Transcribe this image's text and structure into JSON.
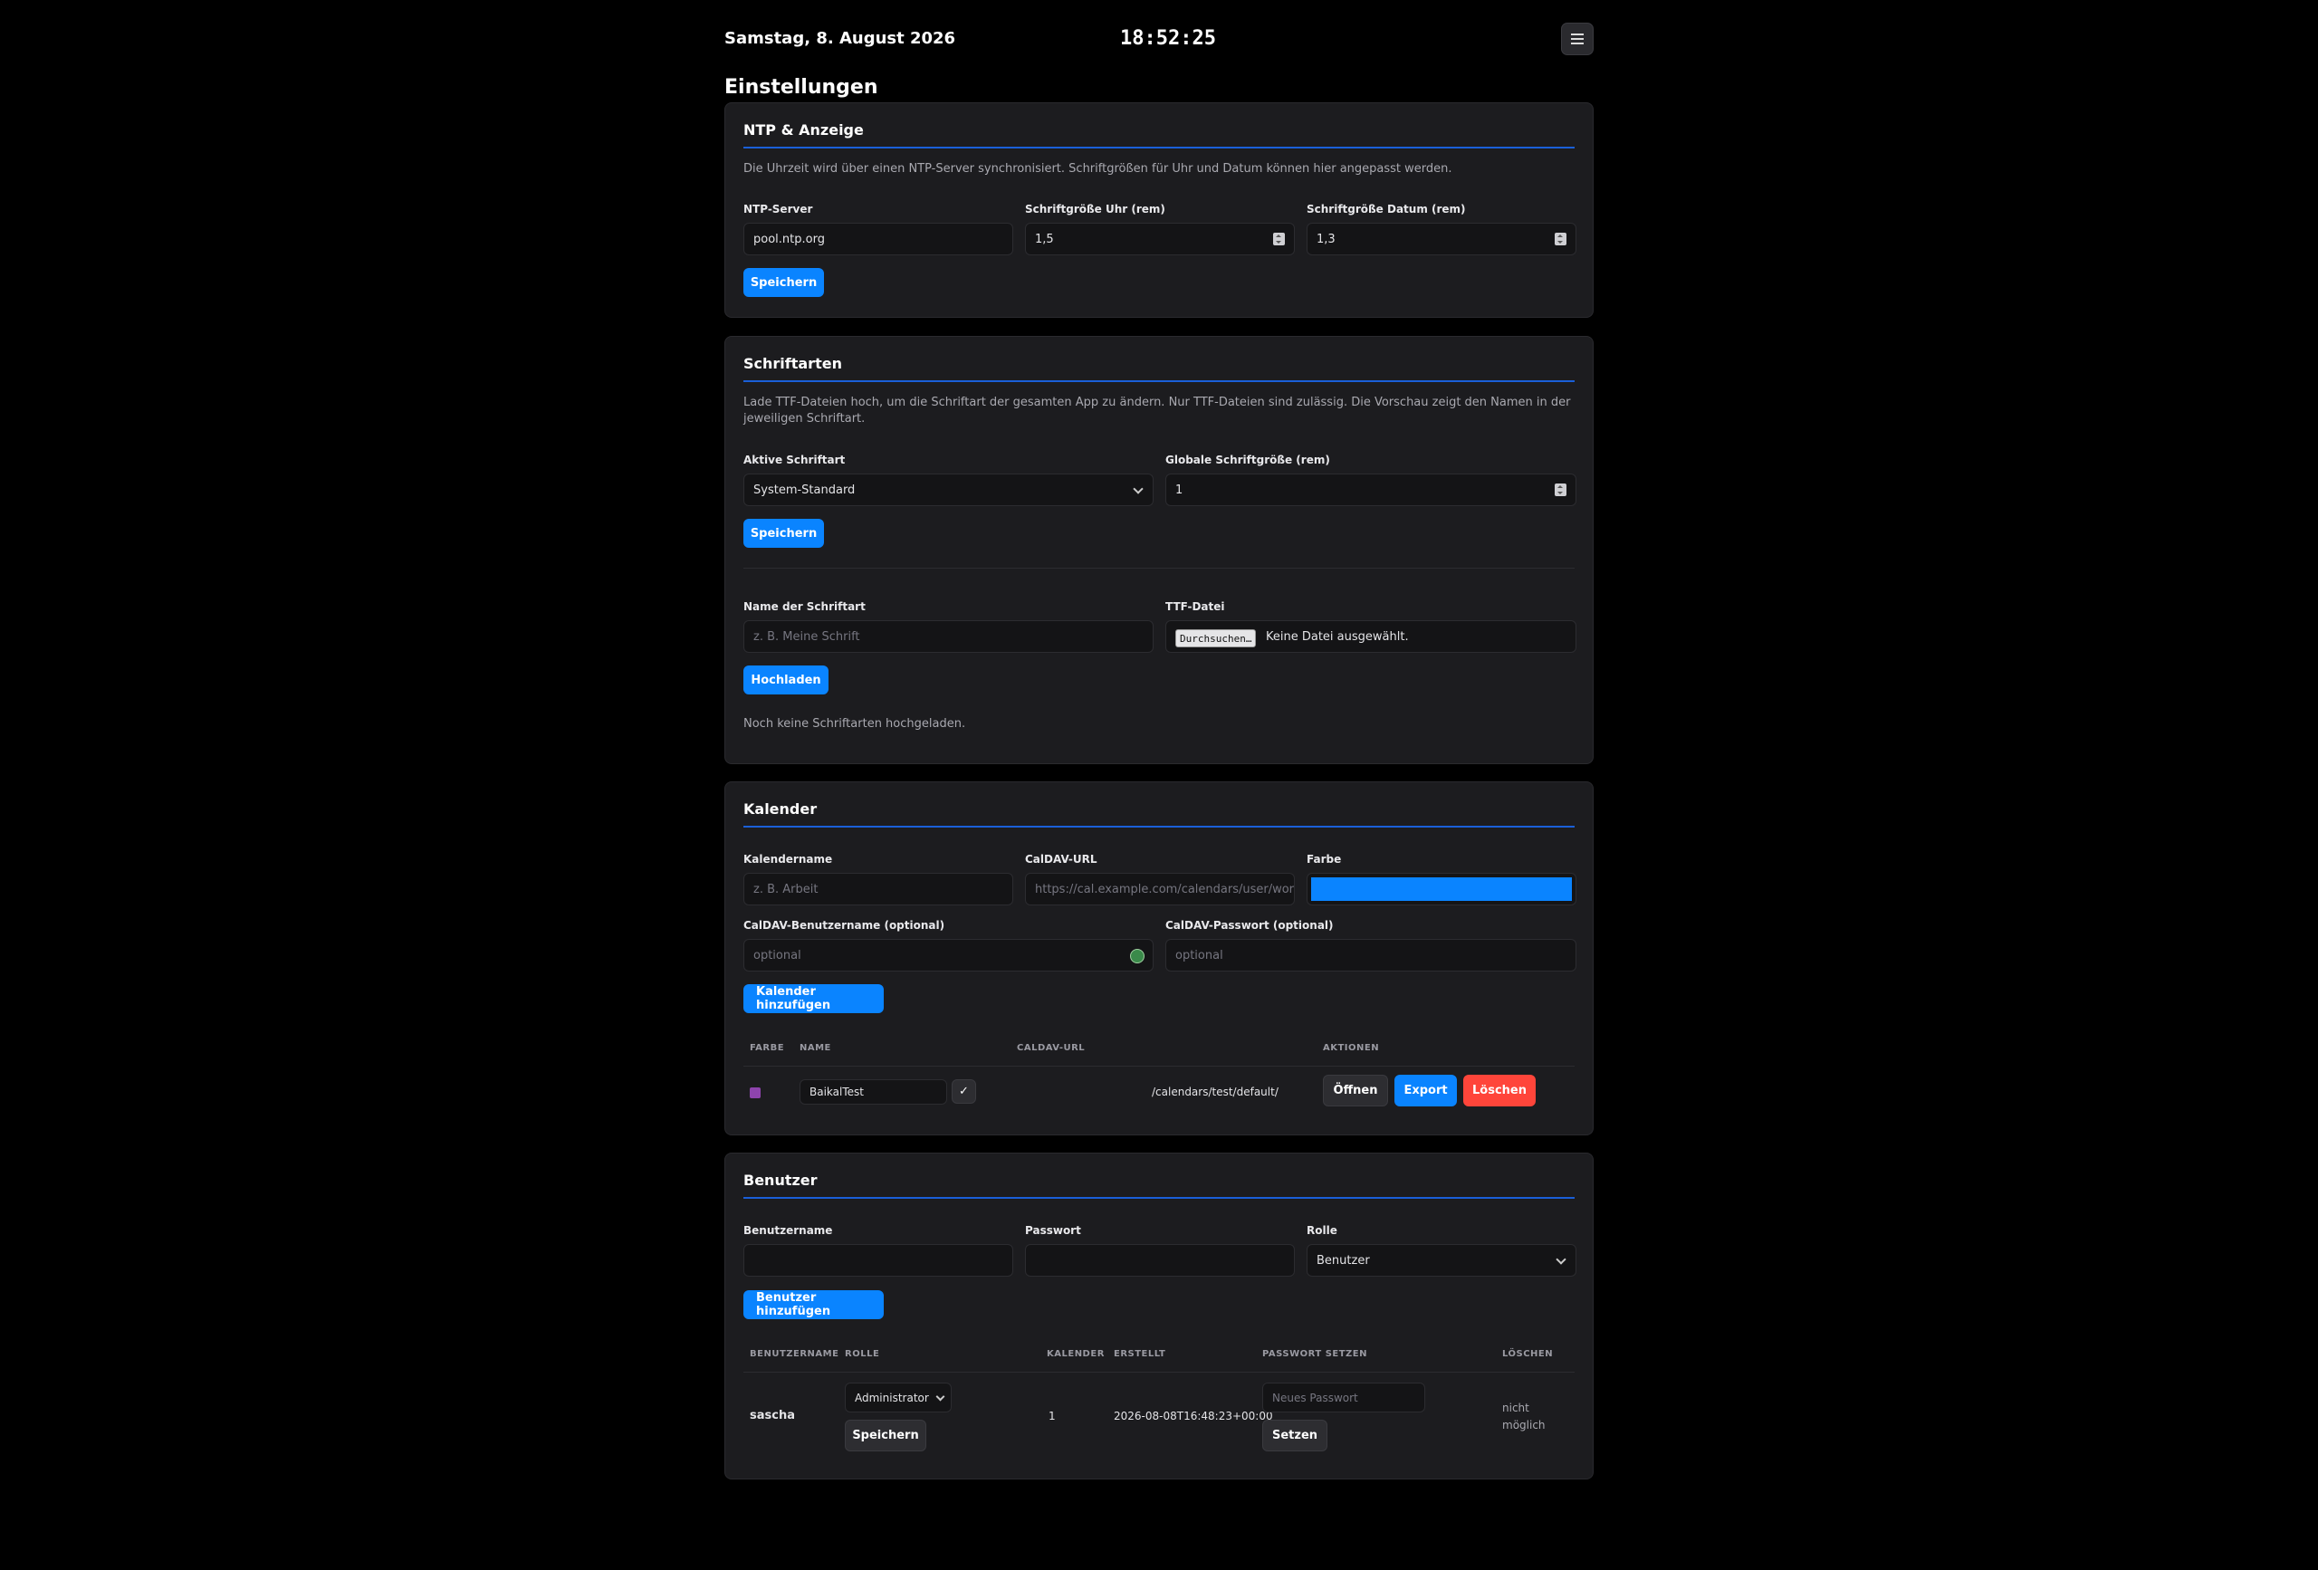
{
  "header": {
    "date": "Samstag, 8. August 2026",
    "time": "18:52:25",
    "menu_icon": "hamburger-icon"
  },
  "page": {
    "title": "Einstellungen"
  },
  "ntp": {
    "title": "NTP & Anzeige",
    "description": "Die Uhrzeit wird über einen NTP-Server synchronisiert. Schriftgrößen für Uhr und Datum können hier angepasst werden.",
    "server_label": "NTP-Server",
    "server_value": "pool.ntp.org",
    "clock_size_label": "Schriftgröße Uhr (rem)",
    "clock_size_value": "1,5",
    "date_size_label": "Schriftgröße Datum (rem)",
    "date_size_value": "1,3",
    "save_label": "Speichern"
  },
  "fonts": {
    "title": "Schriftarten",
    "description": "Lade TTF-Dateien hoch, um die Schriftart der gesamten App zu ändern. Nur TTF-Dateien sind zulässig. Die Vorschau zeigt den Namen in der jeweiligen Schriftart.",
    "active_label": "Aktive Schriftart",
    "active_value": "System-Standard",
    "global_size_label": "Globale Schriftgröße (rem)",
    "global_size_value": "1",
    "save_label": "Speichern",
    "name_label": "Name der Schriftart",
    "name_placeholder": "z. B. Meine Schrift",
    "file_label": "TTF-Datei",
    "file_button": "Durchsuchen…",
    "file_status": "Keine Datei ausgewählt.",
    "upload_label": "Hochladen",
    "empty_text": "Noch keine Schriftarten hochgeladen."
  },
  "calendar": {
    "title": "Kalender",
    "name_label": "Kalendername",
    "name_placeholder": "z. B. Arbeit",
    "url_label": "CalDAV-URL",
    "url_placeholder": "https://cal.example.com/calendars/user/work/",
    "color_label": "Farbe",
    "color_value": "#0a84ff",
    "user_label": "CalDAV-Benutzername (optional)",
    "user_placeholder": "optional",
    "pass_label": "CalDAV-Passwort (optional)",
    "pass_placeholder": "optional",
    "add_label": "Kalender hinzufügen",
    "columns": [
      "FARBE",
      "NAME",
      "CALDAV-URL",
      "AKTIONEN"
    ],
    "rows": [
      {
        "color": "#8e44ad",
        "name": "BaikalTest",
        "confirm": "✓",
        "url": "/calendars/test/default/",
        "open_label": "Öffnen",
        "export_label": "Export",
        "delete_label": "Löschen"
      }
    ]
  },
  "users": {
    "title": "Benutzer",
    "username_label": "Benutzername",
    "password_label": "Passwort",
    "role_label": "Rolle",
    "role_value": "Benutzer",
    "add_label": "Benutzer hinzufügen",
    "columns": [
      "BENUTZERNAME",
      "ROLLE",
      "KALENDER",
      "ERSTELLT",
      "PASSWORT SETZEN",
      "LÖSCHEN"
    ],
    "rows": [
      {
        "username": "sascha",
        "role": "Administrator",
        "save_label": "Speichern",
        "calendars": "1",
        "created": "2026-08-08T16:48:23+00:00",
        "new_password_placeholder": "Neues Passwort",
        "set_label": "Setzen",
        "delete_text": "nicht möglich"
      }
    ]
  }
}
